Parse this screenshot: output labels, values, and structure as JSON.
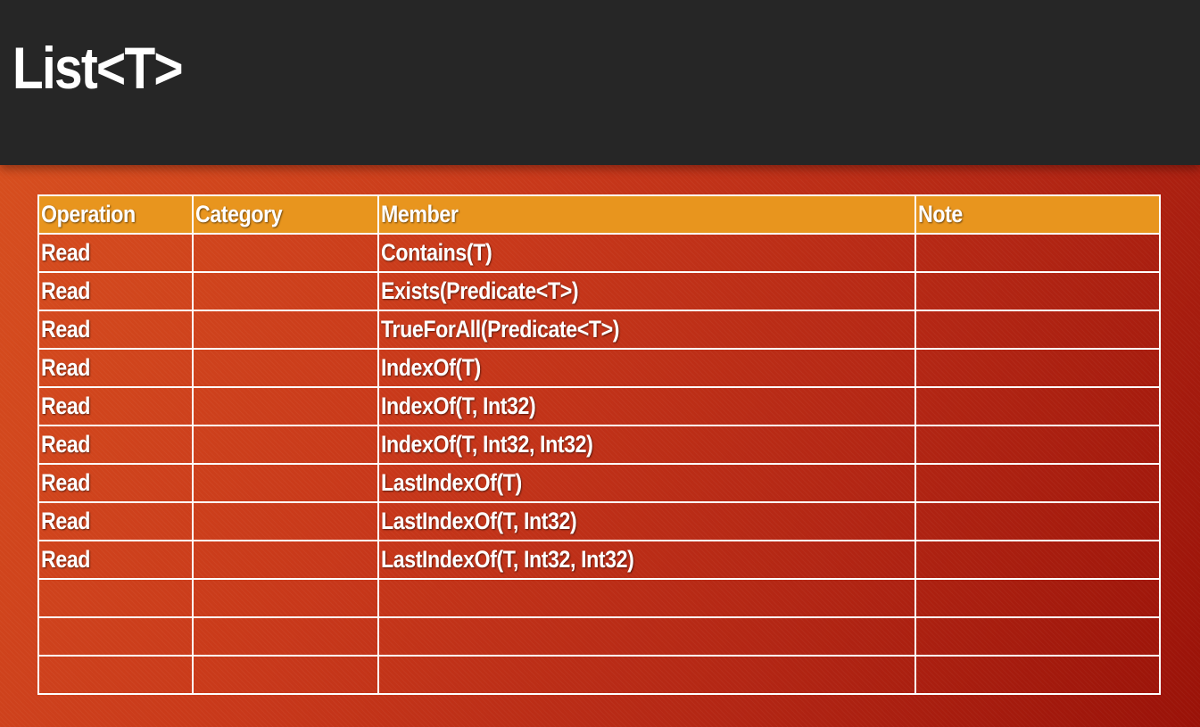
{
  "title": "List<T>",
  "table": {
    "headers": [
      "Operation",
      "Category",
      "Member",
      "Note"
    ],
    "rows": [
      {
        "operation": "Read",
        "category": "",
        "member": "Contains(T)",
        "note": ""
      },
      {
        "operation": "Read",
        "category": "",
        "member": "Exists(Predicate<T>)",
        "note": ""
      },
      {
        "operation": "Read",
        "category": "",
        "member": "TrueForAll(Predicate<T>)",
        "note": ""
      },
      {
        "operation": "Read",
        "category": "",
        "member": "IndexOf(T)",
        "note": ""
      },
      {
        "operation": "Read",
        "category": "",
        "member": "IndexOf(T, Int32)",
        "note": ""
      },
      {
        "operation": "Read",
        "category": "",
        "member": "IndexOf(T, Int32, Int32)",
        "note": ""
      },
      {
        "operation": "Read",
        "category": "",
        "member": "LastIndexOf(T)",
        "note": ""
      },
      {
        "operation": "Read",
        "category": "",
        "member": "LastIndexOf(T, Int32)",
        "note": ""
      },
      {
        "operation": "Read",
        "category": "",
        "member": "LastIndexOf(T, Int32, Int32)",
        "note": ""
      },
      {
        "operation": "",
        "category": "",
        "member": "",
        "note": ""
      },
      {
        "operation": "",
        "category": "",
        "member": "",
        "note": ""
      },
      {
        "operation": "",
        "category": "",
        "member": "",
        "note": ""
      }
    ]
  },
  "colors": {
    "title_bar": "#262626",
    "header_fill": "#e8951e",
    "background_start": "#d9521f",
    "background_end": "#9a1208",
    "grid_lines": "#ffffff"
  }
}
